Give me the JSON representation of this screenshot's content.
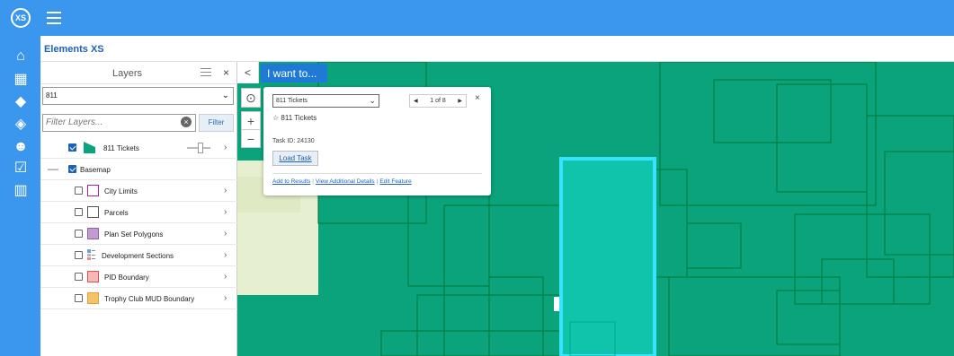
{
  "app": {
    "logo_text": "XS",
    "title": "Elements XS"
  },
  "rail": [
    {
      "icon": "home-icon",
      "glyph": "⌂"
    },
    {
      "icon": "building-icon",
      "glyph": "▦"
    },
    {
      "icon": "paint-bucket-icon",
      "glyph": "◆"
    },
    {
      "icon": "map-pin-icon",
      "glyph": "◈"
    },
    {
      "icon": "users-icon",
      "glyph": "☻"
    },
    {
      "icon": "checkbox-icon",
      "glyph": "☑"
    },
    {
      "icon": "chart-icon",
      "glyph": "▥"
    }
  ],
  "layers": {
    "title": "Layers",
    "close": "×",
    "dropdown_value": "811",
    "filter_placeholder": "Filter Layers...",
    "filter_button": "Filter",
    "items": [
      {
        "label": "811 Tickets",
        "checked": true
      },
      {
        "label": "Basemap",
        "checked": true
      },
      {
        "label": "City Limits",
        "checked": false,
        "swatch": "#ffffff",
        "border": "#b0209a"
      },
      {
        "label": "Parcels",
        "checked": false,
        "swatch": "#ffffff",
        "border": "#555555"
      },
      {
        "label": "Plan Set Polygons",
        "checked": false,
        "swatch": "#c39bd3",
        "border": "#8e5fa8"
      },
      {
        "label": "Development Sections",
        "checked": false
      },
      {
        "label": "PID Boundary",
        "checked": false,
        "swatch": "#f7b7b7",
        "border": "#d9534f"
      },
      {
        "label": "Trophy Club MUD Boundary",
        "checked": false,
        "swatch": "#f5c26b",
        "border": "#e0a030"
      }
    ]
  },
  "map": {
    "i_want_to": "I want to...",
    "collapse": "<",
    "zoom_in": "+",
    "zoom_out": "−",
    "locate": "⊙"
  },
  "popup": {
    "layer_select": "811 Tickets",
    "pager": "1 of 8",
    "close": "×",
    "feature_title": "811 Tickets",
    "task_id": "Task ID: 24130",
    "load_task": "Load Task",
    "links": [
      "Add to Results",
      "View Additional Details",
      "Edit Feature"
    ]
  },
  "colors": {
    "accent": "#3a97ed",
    "map_fill": "#0aa37b",
    "highlight": "#00c8b0"
  }
}
